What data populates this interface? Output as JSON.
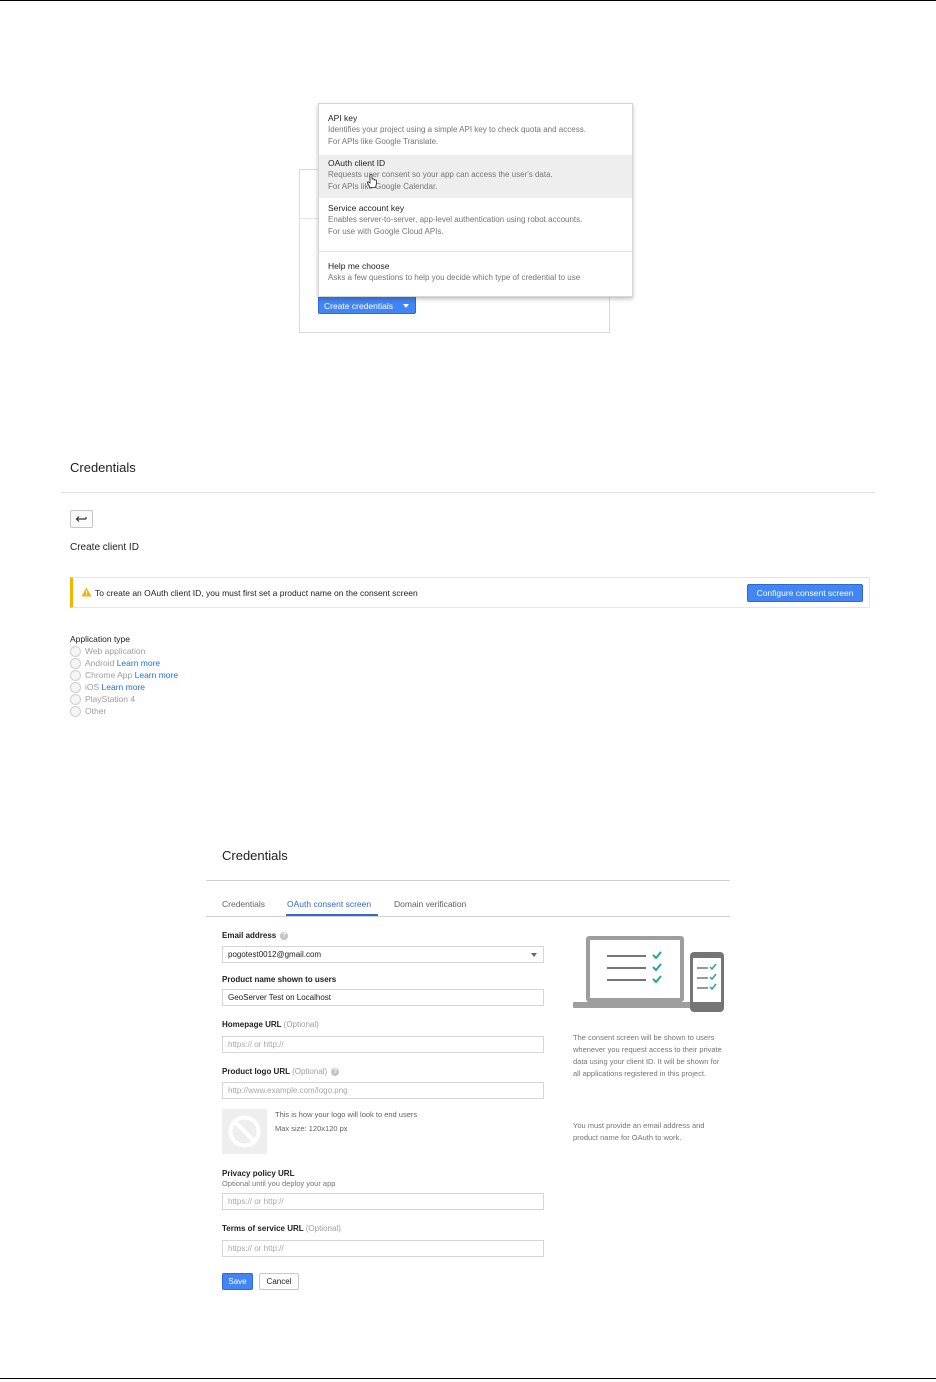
{
  "create_credentials": {
    "button_label": "Create credentials",
    "menu": [
      {
        "title": "API key",
        "desc": [
          "Identifies your project using a simple API key to check quota and access.",
          "For APIs like Google Translate."
        ]
      },
      {
        "title": "OAuth client ID",
        "desc": [
          "Requests user consent so your app can access the user's data.",
          "For APIs like Google Calendar."
        ]
      },
      {
        "title": "Service account key",
        "desc": [
          "Enables server-to-server, app-level authentication using robot accounts.",
          "For use with Google Cloud APIs."
        ]
      },
      {
        "title": "Help me choose",
        "desc": [
          "Asks a few questions to help you decide which type of credential to use"
        ]
      }
    ]
  },
  "client_id": {
    "title": "Credentials",
    "subtitle": "Create client ID",
    "warning": "To create an OAuth client ID, you must first set a product name on the consent screen",
    "configure_button": "Configure consent screen",
    "app_type_label": "Application type",
    "app_types": [
      {
        "label": "Web application",
        "link": ""
      },
      {
        "label": "Android",
        "link": "Learn more"
      },
      {
        "label": "Chrome App",
        "link": "Learn more"
      },
      {
        "label": "iOS",
        "link": "Learn more"
      },
      {
        "label": "PlayStation 4",
        "link": ""
      },
      {
        "label": "Other",
        "link": ""
      }
    ]
  },
  "consent": {
    "title": "Credentials",
    "tabs": [
      "Credentials",
      "OAuth consent screen",
      "Domain verification"
    ],
    "active_tab": "OAuth consent screen",
    "email_label": "Email address",
    "email_value": "pogotest0012@gmail.com",
    "product_label": "Product name shown to users",
    "product_value": "GeoServer Test on Localhost",
    "homepage_label": "Homepage URL",
    "homepage_optional": "(Optional)",
    "homepage_placeholder": "https:// or http://",
    "logo_label": "Product logo URL",
    "logo_optional": "(Optional)",
    "logo_placeholder": "http://www.example.com/logo.png",
    "logo_note_1": "This is how your logo will look to end users",
    "logo_note_2": "Max size: 120x120 px",
    "privacy_label": "Privacy policy URL",
    "privacy_sub": "Optional until you deploy your app",
    "privacy_placeholder": "https:// or http://",
    "tos_label": "Terms of service URL",
    "tos_optional": "(Optional)",
    "tos_placeholder": "https:// or http://",
    "save": "Save",
    "cancel": "Cancel",
    "side_text_1": "The consent screen will be shown to users whenever you request access to their private data using your client ID. It will be shown for all applications registered in this project.",
    "side_text_2": "You must provide an email address and product name for OAuth to work."
  },
  "colors": {
    "primary": "#4285f4",
    "warning": "#f4b400",
    "check": "#26a69a"
  }
}
